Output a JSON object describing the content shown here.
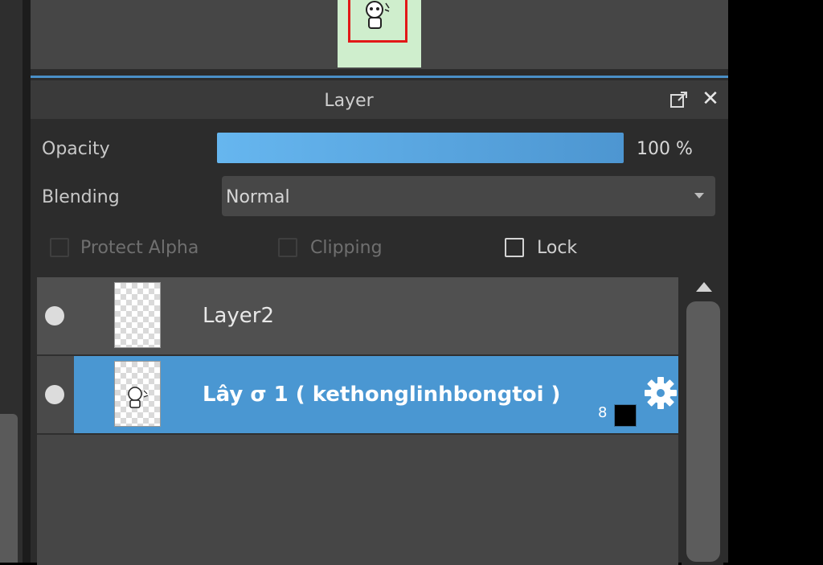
{
  "panel": {
    "title": "Layer",
    "opacity_label": "Opacity",
    "opacity_value": "100 %",
    "blending_label": "Blending",
    "blending_value": "Normal",
    "options": [
      {
        "label": "Protect Alpha",
        "checked": false,
        "enabled": false
      },
      {
        "label": "Clipping",
        "checked": false,
        "enabled": false
      },
      {
        "label": "Lock",
        "checked": false,
        "enabled": true
      }
    ]
  },
  "layers": [
    {
      "name": "Layer2",
      "visible": true,
      "selected": false
    },
    {
      "name": "Lây σ 1 ( kethonglinhbongtoi )",
      "visible": true,
      "selected": true,
      "badge": "8",
      "swatch_color": "#000000"
    }
  ],
  "colors": {
    "accent": "#4a97d2",
    "panel_bg": "#2c2c2c",
    "navigator_bg": "#464646",
    "thumbnail_bg": "#cfeecd",
    "view_rect": "#e21818"
  },
  "icons": {
    "popout": "popout-icon",
    "close": "close-icon",
    "gear": "gear-icon",
    "scroll_up": "triangle-up-icon",
    "dropdown": "chevron-down-icon"
  }
}
